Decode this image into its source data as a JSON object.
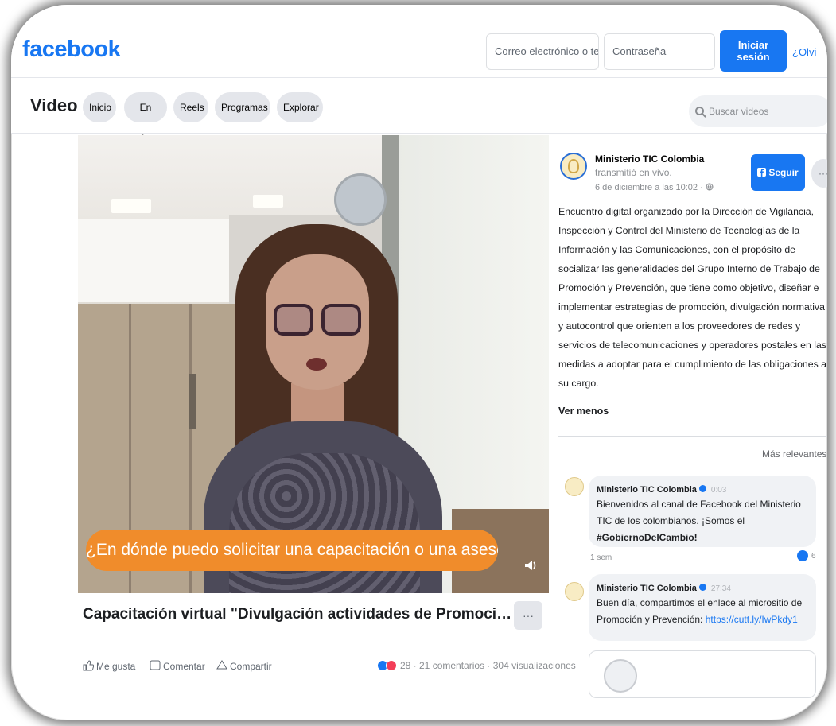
{
  "header": {
    "logo": "facebook",
    "email_placeholder": "Correo electrónico o telé",
    "password_placeholder": "Contraseña",
    "login_label": "Iniciar sesión",
    "forgot_label": "¿Olvi"
  },
  "nav": {
    "section_title": "Video",
    "tabs": [
      {
        "label": "Inicio"
      },
      {
        "label": "En vivo"
      },
      {
        "label": "Reels"
      },
      {
        "label": "Programas"
      },
      {
        "label": "Explorar"
      }
    ],
    "search_placeholder": "Buscar videos"
  },
  "video": {
    "caption": "¿En dónde puedo solicitar una capacitación o una asesoría?",
    "title": "Capacitación virtual \"Divulgación actividades de Promoción y Prevenció...",
    "more_label": "···",
    "actions": {
      "like": "Me gusta",
      "comment": "Comentar",
      "share": "Compartir"
    },
    "stats": "28 · 21 comentarios · 304 visualizaciones"
  },
  "post": {
    "page_name": "Ministerio TIC Colombia",
    "action_text": "transmitió en vivo.",
    "date": "6 de diciembre a las 10:02 ·",
    "follow_label": "Seguir",
    "more_label": "···",
    "description": "Encuentro digital organizado por la Dirección de Vigilancia, Inspección y Control del Ministerio de Tecnologías de la Información y las Comunicaciones, con el propósito de socializar las generalidades del Grupo Interno de Trabajo de Promoción y Prevención, que tiene como objetivo, diseñar e implementar estrategias de promoción, divulgación normativa y autocontrol que orienten a los proveedores de redes y servicios de telecomunicaciones y operadores postales en las medidas a adoptar para el cumplimiento de las obligaciones a su cargo.",
    "see_less": "Ver menos",
    "sort_label": "Más relevantes ▾"
  },
  "comments": [
    {
      "author": "Ministerio TIC Colombia",
      "time": "0:03",
      "text_before": "Bienvenidos al canal de Facebook del Ministerio TIC de los colombianos. ¡Somos el ",
      "text_bold": "#GobiernoDelCambio!",
      "meta": "1 sem",
      "likes": "6"
    },
    {
      "author": "Ministerio TIC Colombia",
      "time": "27:34",
      "text_before": "Buen día, compartimos el enlace al micrositio de Promoción y Prevención: ",
      "link": "https://cutt.ly/IwPkdy1"
    }
  ],
  "colors": {
    "brand": "#1877f2",
    "caption_bg": "#f08c2b"
  }
}
